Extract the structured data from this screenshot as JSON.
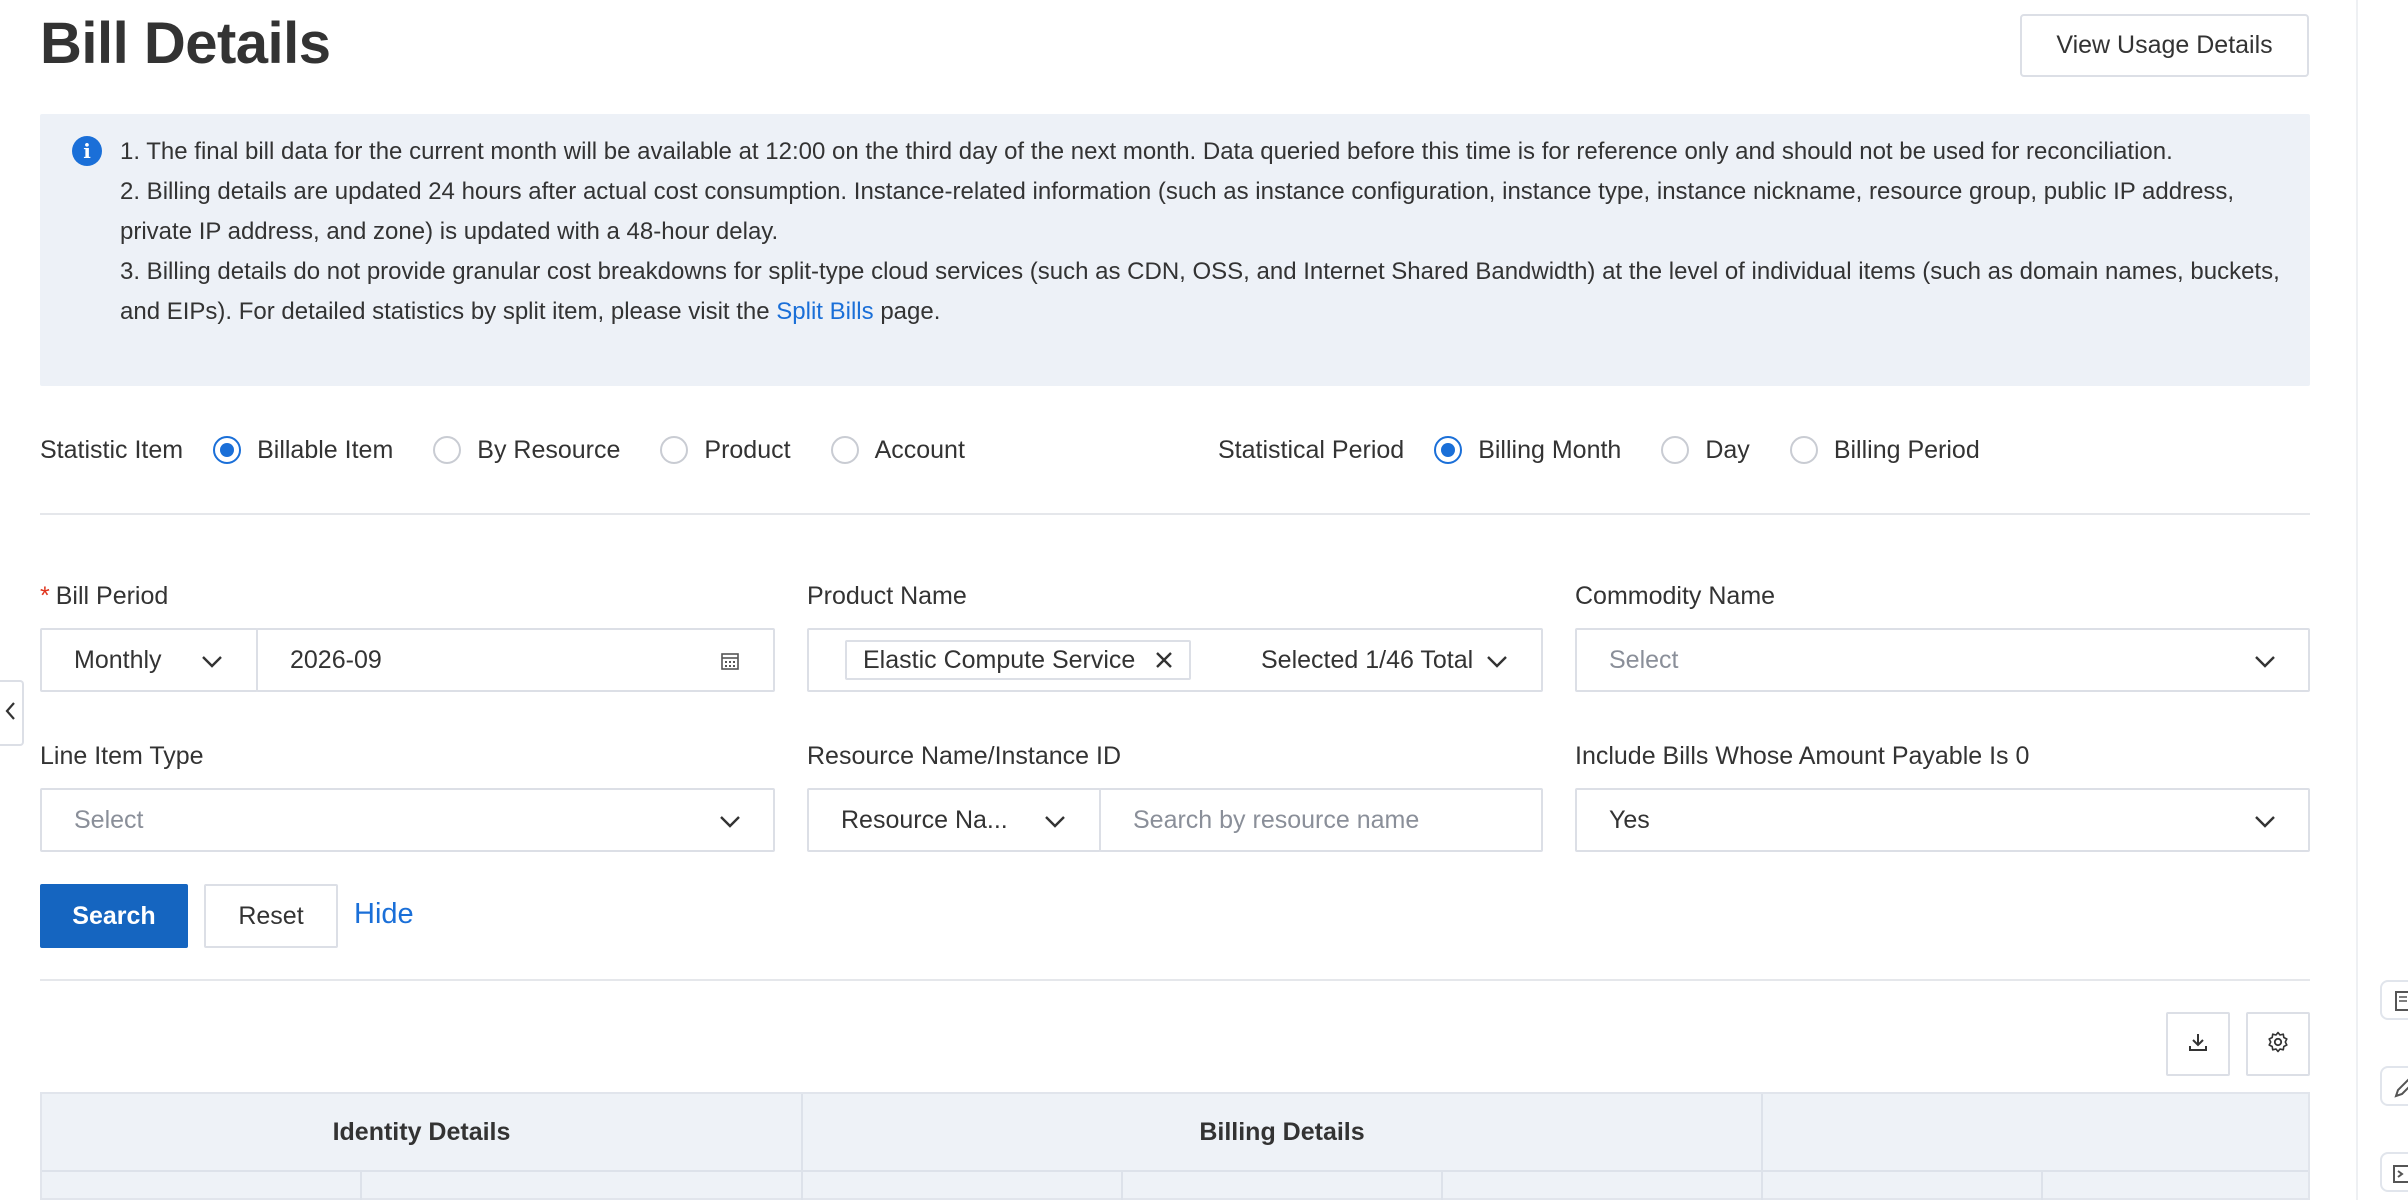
{
  "header": {
    "title": "Bill Details",
    "usage_button": "View Usage Details"
  },
  "notice": {
    "line1": "1. The final bill data for the current month will be available at 12:00 on the third day of the next month. Data queried before this time is for reference only and should not be used for reconciliation.",
    "line2": "2. Billing details are updated 24 hours after actual cost consumption. Instance-related information (such as instance configuration, instance type, instance nickname, resource group, public IP address, private IP address, and zone) is updated with a 48-hour delay.",
    "line3_prefix": "3. Billing details do not provide granular cost breakdowns for split-type cloud services (such as CDN, OSS, and Internet Shared Bandwidth) at the level of individual items (such as domain names, buckets, and EIPs). For detailed statistics by split item, please visit the",
    "line3_link": "Split Bills",
    "line3_suffix": "page."
  },
  "statistic_item": {
    "label": "Statistic Item",
    "options": [
      "Billable Item",
      "By Resource",
      "Product",
      "Account"
    ],
    "selected": "Billable Item"
  },
  "statistical_period": {
    "label": "Statistical Period",
    "options": [
      "Billing Month",
      "Day",
      "Billing Period"
    ],
    "selected": "Billing Month"
  },
  "filters": {
    "bill_period": {
      "required_mark": "*",
      "label": "Bill Period",
      "mode": "Monthly",
      "value": "2026-09"
    },
    "product_name": {
      "label": "Product Name",
      "tag": "Elastic Compute Service",
      "summary": "Selected 1/46 Total"
    },
    "commodity_name": {
      "label": "Commodity Name",
      "placeholder": "Select"
    },
    "line_item_type": {
      "label": "Line Item Type",
      "placeholder": "Select"
    },
    "resource": {
      "label": "Resource Name/Instance ID",
      "mode": "Resource Na...",
      "placeholder": "Search by resource name"
    },
    "include_zero": {
      "label": "Include Bills Whose Amount Payable Is 0",
      "value": "Yes"
    }
  },
  "actions": {
    "search": "Search",
    "reset": "Reset",
    "hide": "Hide"
  },
  "table": {
    "group_headers": [
      "Identity Details",
      "Billing Details",
      ""
    ]
  },
  "colors": {
    "primary": "#1565c0",
    "link": "#1a6fd8",
    "notice_bg": "#edf1f7",
    "required": "#e0341d"
  }
}
